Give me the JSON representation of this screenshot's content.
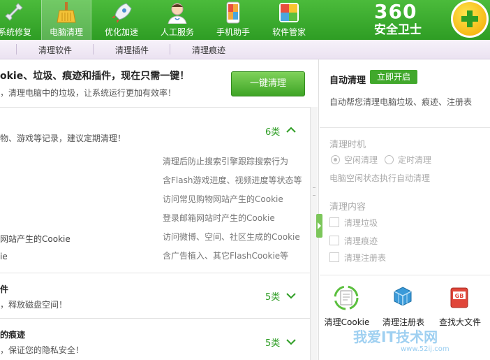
{
  "nav": {
    "tabs": [
      {
        "label": "系统修复",
        "icon": "wrench-icon"
      },
      {
        "label": "电脑清理",
        "icon": "broom-icon"
      },
      {
        "label": "优化加速",
        "icon": "rocket-icon"
      },
      {
        "label": "人工服务",
        "icon": "doctor-icon"
      },
      {
        "label": "手机助手",
        "icon": "phone-icon"
      },
      {
        "label": "软件管家",
        "icon": "software-box-icon"
      }
    ],
    "active_index": 1
  },
  "logo": {
    "top": "360",
    "bottom": "安全卫士"
  },
  "subnav": {
    "items": [
      "清理软件",
      "清理插件",
      "清理痕迹"
    ]
  },
  "main": {
    "headline": "okie、垃圾、痕迹和插件，现在只需一键！",
    "subline": "，清理电脑中的垃圾，让系统运行更加有效率！",
    "clean_button": "一键清理",
    "section1": {
      "text": "物、游戏等记录，建议定期清理！",
      "count": "6类",
      "items_left": [
        "网站产生的Cookie",
        "ie"
      ],
      "descriptions": [
        "清理后防止搜索引擎跟踪搜索行为",
        "含Flash游戏进度、视频进度等状态等",
        "访问常见购物网站产生的Cookie",
        "登录邮箱网站时产生的Cookie",
        "访问微博、空间、社区生成的Cookie",
        "含广告植入、其它FlashCookie等"
      ]
    },
    "section2": {
      "title": "件",
      "text": "，释放磁盘空间！",
      "count": "5类"
    },
    "section3": {
      "title": "的痕迹",
      "text": "，保证您的隐私安全！",
      "count": "5类"
    }
  },
  "side": {
    "auto_title": "自动清理",
    "start_button": "立即开启",
    "auto_desc": "自动帮您清理电脑垃圾、痕迹、注册表",
    "time_title": "清理时机",
    "radio_idle": "空闲清理",
    "radio_timed": "定时清理",
    "idle_desc": "电脑空闲状态执行自动清理",
    "content_title": "清理内容",
    "checks": [
      "清理垃圾",
      "清理痕迹",
      "清理注册表"
    ],
    "tools": [
      "清理Cookie",
      "清理注册表",
      "查找大文件"
    ]
  },
  "watermark": {
    "text": "我爱IT技术网",
    "url": "www.52ij.com"
  },
  "colors": {
    "brand_green": "#2e9d24",
    "button_green": "#41a82c"
  }
}
